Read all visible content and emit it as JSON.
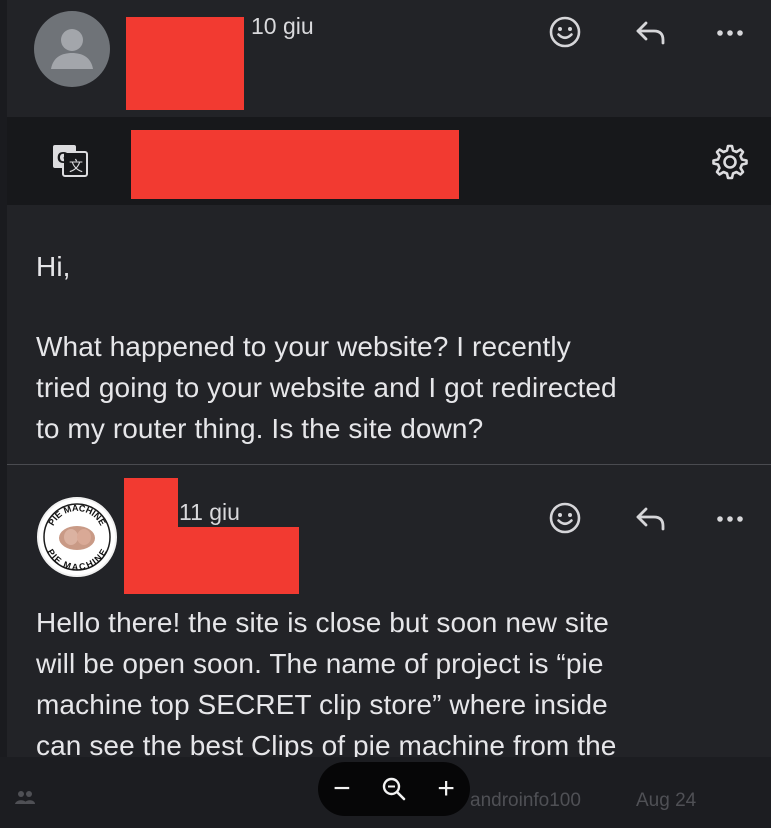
{
  "message1": {
    "date": "10 giu",
    "greeting": "Hi,",
    "body_lines": [
      "What happened to your website? I recently",
      "tried going to your website and I got redirected",
      "to my router thing. Is the site down?"
    ]
  },
  "message2": {
    "date": "11 giu",
    "avatar_text_top": "PIE MACHINE",
    "avatar_text_bottom": "PIE MACHINE",
    "body_lines": [
      "Hello there! the site is close but soon new site",
      "will be open soon. The name of project is “pie",
      "machine top SECRET clip store” where inside",
      "can see the best Clips of pie machine from the"
    ]
  },
  "background_list": {
    "sender": "androinfo100",
    "date": "Aug 24"
  },
  "zoom_controls": {
    "minus": "−",
    "plus": "+"
  },
  "colors": {
    "redaction": "#f23a31",
    "background": "#222327",
    "translate_bar": "#17181b"
  },
  "icons": [
    "emoji-icon",
    "reply-icon",
    "more-icon",
    "translate-icon",
    "gear-icon",
    "zoom-icon",
    "people-icon"
  ]
}
